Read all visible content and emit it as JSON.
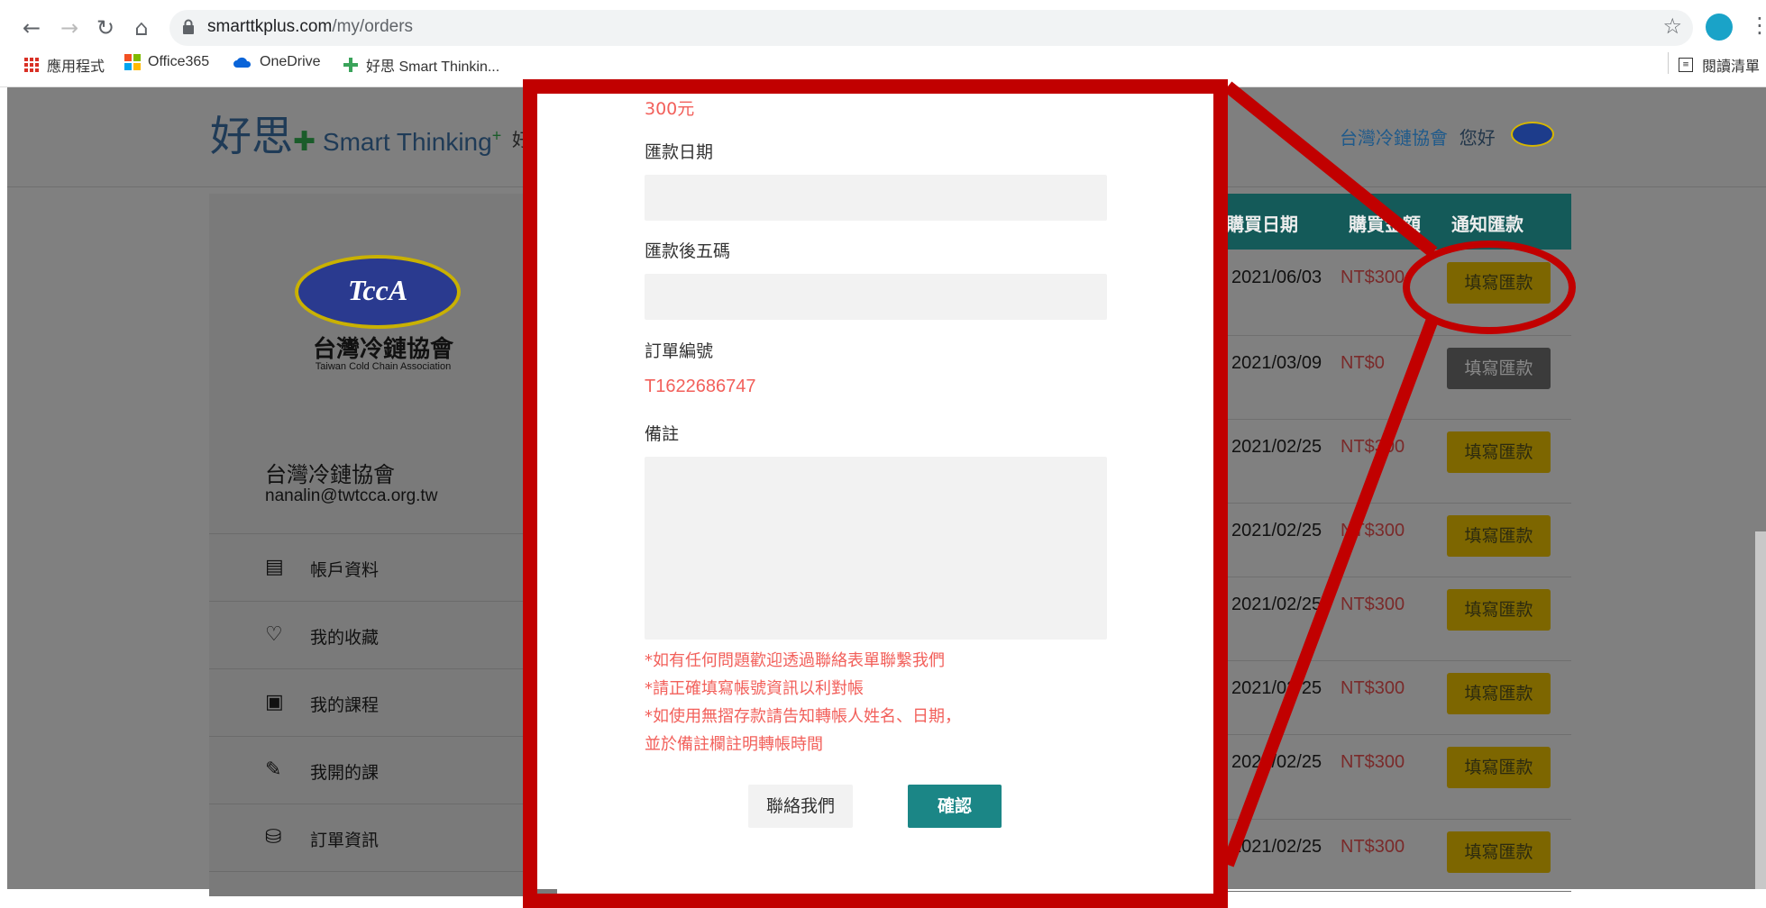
{
  "browser": {
    "url_host": "smarttkplus.com",
    "url_path": "/my/orders",
    "bookmarks": [
      "應用程式",
      "Office365",
      "OneDrive",
      "好思 Smart Thinkin..."
    ],
    "reading_list": "閱讀清單"
  },
  "header": {
    "logo_cn": "好思",
    "logo_en": "Smart Thinking",
    "nav_fragment": "好",
    "org": "台灣冷鏈協會",
    "greeting": "您好"
  },
  "sidebar": {
    "logo_text": "TccA",
    "org_cn": "台灣冷鏈協會",
    "org_en": "Taiwan Cold Chain Association",
    "account_name": "台灣冷鏈協會",
    "account_email": "nanalin@twtcca.org.tw",
    "menu": [
      {
        "label": "帳戶資料",
        "icon": "account-icon"
      },
      {
        "label": "我的收藏",
        "icon": "favorites-icon"
      },
      {
        "label": "我的課程",
        "icon": "courses-icon"
      },
      {
        "label": "我開的課",
        "icon": "teaching-icon"
      },
      {
        "label": "訂單資訊",
        "icon": "orders-icon"
      }
    ]
  },
  "orders": {
    "headers": {
      "date": "購買日期",
      "price": "購買金額",
      "action": "通知匯款"
    },
    "rows": [
      {
        "date": "2021/06/03",
        "price": "NT$300",
        "button": "填寫匯款",
        "enabled": true
      },
      {
        "date": "2021/03/09",
        "price": "NT$0",
        "button": "填寫匯款",
        "enabled": false
      },
      {
        "date": "2021/02/25",
        "price": "NT$300",
        "button": "填寫匯款",
        "enabled": true
      },
      {
        "date": "2021/02/25",
        "price": "NT$300",
        "button": "填寫匯款",
        "enabled": true
      },
      {
        "date": "2021/02/25",
        "price": "NT$300",
        "button": "填寫匯款",
        "enabled": true
      },
      {
        "date": "2021/02/25",
        "price": "NT$300",
        "button": "填寫匯款",
        "enabled": true
      },
      {
        "date": "2021/02/25",
        "price": "NT$300",
        "button": "填寫匯款",
        "enabled": true
      },
      {
        "date": "2021/02/25",
        "price": "NT$300",
        "button": "填寫匯款",
        "enabled": true
      }
    ]
  },
  "modal": {
    "amount": "300元",
    "remit_date_label": "匯款日期",
    "remit_date_value": "",
    "last5_label": "匯款後五碼",
    "last5_value": "",
    "order_no_label": "訂單編號",
    "order_no": "T1622686747",
    "remark_label": "備註",
    "remark_value": "",
    "notes": [
      "*如有任何問題歡迎透過聯絡表單聯繫我們",
      "*請正確填寫帳號資訊以利對帳",
      "*如使用無摺存款請告知轉帳人姓名、日期，",
      "並於備註欄註明轉帳時間"
    ],
    "contact_label": "聯絡我們",
    "confirm_label": "確認"
  },
  "colors": {
    "annotation_red": "#c10000",
    "table_head": "#1b8686",
    "pay_button": "#f2c200",
    "accent_red": "#f2605b"
  }
}
